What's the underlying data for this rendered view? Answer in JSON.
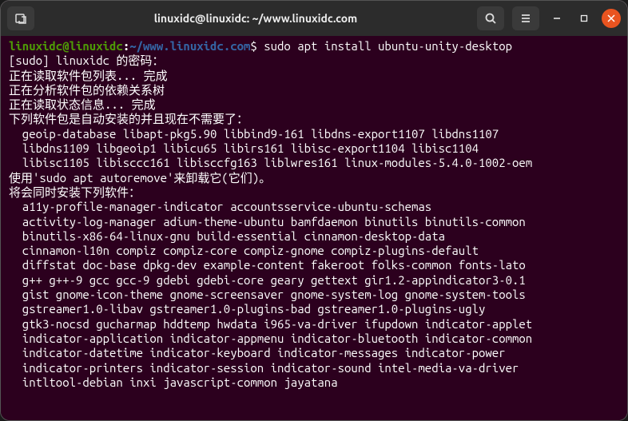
{
  "titlebar": {
    "title": "linuxidc@linuxidc: ~/www.linuxidc.com"
  },
  "prompt": {
    "user_host": "linuxidc@linuxidc",
    "colon": ":",
    "path": "~/www.linuxidc.com",
    "symbol": "$",
    "command": "sudo apt install ubuntu-unity-desktop"
  },
  "output": {
    "l1": "[sudo] linuxidc 的密码：",
    "l2": "正在读取软件包列表... 完成",
    "l3": "正在分析软件包的依赖关系树",
    "l4": "正在读取状态信息... 完成",
    "l5": "下列软件包是自动安装的并且现在不需要了：",
    "l6": "  geoip-database libapt-pkg5.90 libbind9-161 libdns-export1107 libdns1107",
    "l7": "  libdns1109 libgeoip1 libicu65 libirs161 libisc-export1104 libisc1104",
    "l8": "  libisc1105 libisccc161 libisccfg163 liblwres161 linux-modules-5.4.0-1002-oem",
    "l9": "使用'sudo apt autoremove'来卸载它(它们)。",
    "l10": "将会同时安装下列软件：",
    "l11": "  a11y-profile-manager-indicator accountsservice-ubuntu-schemas",
    "l12": "  activity-log-manager adium-theme-ubuntu bamfdaemon binutils binutils-common",
    "l13": "  binutils-x86-64-linux-gnu build-essential cinnamon-desktop-data",
    "l14": "  cinnamon-l10n compiz compiz-core compiz-gnome compiz-plugins-default",
    "l15": "  diffstat doc-base dpkg-dev example-content fakeroot folks-common fonts-lato",
    "l16": "  g++ g++-9 gcc gcc-9 gdebi gdebi-core geary gettext gir1.2-appindicator3-0.1",
    "l17": "  gist gnome-icon-theme gnome-screensaver gnome-system-log gnome-system-tools",
    "l18": "  gstreamer1.0-libav gstreamer1.0-plugins-bad gstreamer1.0-plugins-ugly",
    "l19": "  gtk3-nocsd gucharmap hddtemp hwdata i965-va-driver ifupdown indicator-applet",
    "l20": "  indicator-application indicator-appmenu indicator-bluetooth indicator-common",
    "l21": "  indicator-datetime indicator-keyboard indicator-messages indicator-power",
    "l22": "  indicator-printers indicator-session indicator-sound intel-media-va-driver",
    "l23": "  intltool-debian inxi javascript-common jayatana"
  }
}
